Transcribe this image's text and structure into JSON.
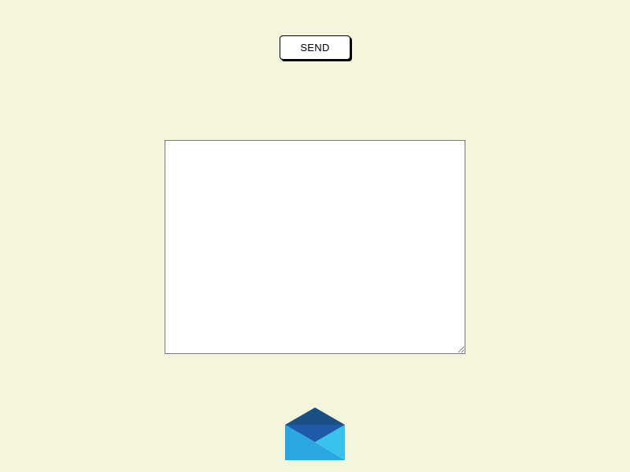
{
  "toolbar": {
    "send_label": "SEND"
  },
  "message": {
    "value": "",
    "placeholder": ""
  },
  "icons": {
    "mail": "open-envelope-icon"
  },
  "colors": {
    "background": "#f5f5dc",
    "envelope_flap": "#1a4f85",
    "envelope_inner": "#1d5aa8",
    "envelope_body_left": "#29a7e1",
    "envelope_body_right": "#38c3ef"
  }
}
